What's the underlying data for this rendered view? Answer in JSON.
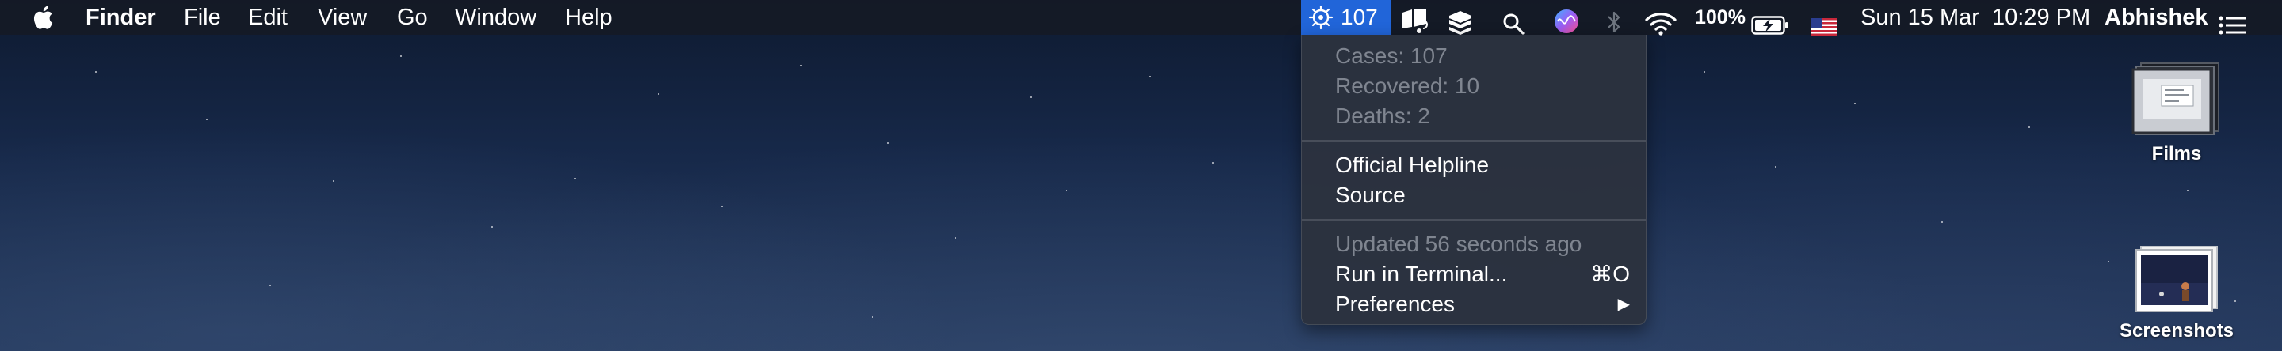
{
  "menubar": {
    "app_name": "Finder",
    "menus": [
      "File",
      "Edit",
      "View",
      "Go",
      "Window",
      "Help"
    ],
    "status": {
      "active_item_count": "107",
      "battery": "100%",
      "datetime": "Sun 15 Mar  10:29 PM",
      "user": "Abhishek"
    },
    "icons": [
      "apple-logo-icon",
      "virus-icon",
      "notifications-icon",
      "inbox-icon",
      "search-icon",
      "siri-icon",
      "bluetooth-icon",
      "wifi-icon",
      "battery-charging-icon",
      "us-flag-icon",
      "list-icon"
    ]
  },
  "dropdown": {
    "stats": [
      "Cases: 107",
      "Recovered: 10",
      "Deaths: 2"
    ],
    "links": [
      "Official Helpline",
      "Source"
    ],
    "updated": "Updated 56 seconds ago",
    "run_terminal": "Run in Terminal...",
    "run_terminal_shortcut": "⌘O",
    "preferences": "Preferences",
    "submenu_arrow": "▶"
  },
  "desktop": {
    "icons": [
      {
        "label": "Films"
      },
      {
        "label": "Screenshots"
      }
    ]
  },
  "colors": {
    "menubar_bg": "#141a26",
    "active_highlight": "#2165d9",
    "dropdown_bg": "#2c323e",
    "disabled_text": "#7f8590"
  }
}
